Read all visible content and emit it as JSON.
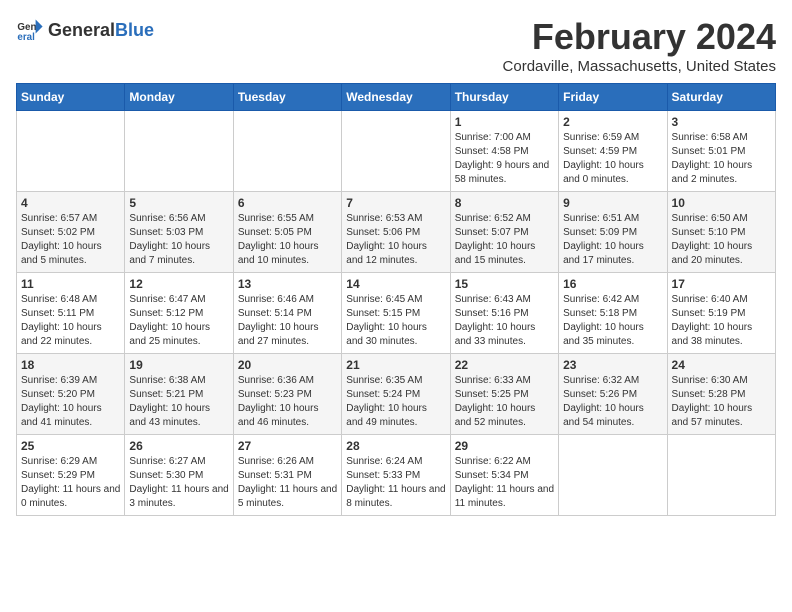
{
  "header": {
    "logo_general": "General",
    "logo_blue": "Blue",
    "month_year": "February 2024",
    "location": "Cordaville, Massachusetts, United States"
  },
  "days_of_week": [
    "Sunday",
    "Monday",
    "Tuesday",
    "Wednesday",
    "Thursday",
    "Friday",
    "Saturday"
  ],
  "weeks": [
    [
      {
        "day": "",
        "info": ""
      },
      {
        "day": "",
        "info": ""
      },
      {
        "day": "",
        "info": ""
      },
      {
        "day": "",
        "info": ""
      },
      {
        "day": "1",
        "info": "Sunrise: 7:00 AM\nSunset: 4:58 PM\nDaylight: 9 hours and 58 minutes."
      },
      {
        "day": "2",
        "info": "Sunrise: 6:59 AM\nSunset: 4:59 PM\nDaylight: 10 hours and 0 minutes."
      },
      {
        "day": "3",
        "info": "Sunrise: 6:58 AM\nSunset: 5:01 PM\nDaylight: 10 hours and 2 minutes."
      }
    ],
    [
      {
        "day": "4",
        "info": "Sunrise: 6:57 AM\nSunset: 5:02 PM\nDaylight: 10 hours and 5 minutes."
      },
      {
        "day": "5",
        "info": "Sunrise: 6:56 AM\nSunset: 5:03 PM\nDaylight: 10 hours and 7 minutes."
      },
      {
        "day": "6",
        "info": "Sunrise: 6:55 AM\nSunset: 5:05 PM\nDaylight: 10 hours and 10 minutes."
      },
      {
        "day": "7",
        "info": "Sunrise: 6:53 AM\nSunset: 5:06 PM\nDaylight: 10 hours and 12 minutes."
      },
      {
        "day": "8",
        "info": "Sunrise: 6:52 AM\nSunset: 5:07 PM\nDaylight: 10 hours and 15 minutes."
      },
      {
        "day": "9",
        "info": "Sunrise: 6:51 AM\nSunset: 5:09 PM\nDaylight: 10 hours and 17 minutes."
      },
      {
        "day": "10",
        "info": "Sunrise: 6:50 AM\nSunset: 5:10 PM\nDaylight: 10 hours and 20 minutes."
      }
    ],
    [
      {
        "day": "11",
        "info": "Sunrise: 6:48 AM\nSunset: 5:11 PM\nDaylight: 10 hours and 22 minutes."
      },
      {
        "day": "12",
        "info": "Sunrise: 6:47 AM\nSunset: 5:12 PM\nDaylight: 10 hours and 25 minutes."
      },
      {
        "day": "13",
        "info": "Sunrise: 6:46 AM\nSunset: 5:14 PM\nDaylight: 10 hours and 27 minutes."
      },
      {
        "day": "14",
        "info": "Sunrise: 6:45 AM\nSunset: 5:15 PM\nDaylight: 10 hours and 30 minutes."
      },
      {
        "day": "15",
        "info": "Sunrise: 6:43 AM\nSunset: 5:16 PM\nDaylight: 10 hours and 33 minutes."
      },
      {
        "day": "16",
        "info": "Sunrise: 6:42 AM\nSunset: 5:18 PM\nDaylight: 10 hours and 35 minutes."
      },
      {
        "day": "17",
        "info": "Sunrise: 6:40 AM\nSunset: 5:19 PM\nDaylight: 10 hours and 38 minutes."
      }
    ],
    [
      {
        "day": "18",
        "info": "Sunrise: 6:39 AM\nSunset: 5:20 PM\nDaylight: 10 hours and 41 minutes."
      },
      {
        "day": "19",
        "info": "Sunrise: 6:38 AM\nSunset: 5:21 PM\nDaylight: 10 hours and 43 minutes."
      },
      {
        "day": "20",
        "info": "Sunrise: 6:36 AM\nSunset: 5:23 PM\nDaylight: 10 hours and 46 minutes."
      },
      {
        "day": "21",
        "info": "Sunrise: 6:35 AM\nSunset: 5:24 PM\nDaylight: 10 hours and 49 minutes."
      },
      {
        "day": "22",
        "info": "Sunrise: 6:33 AM\nSunset: 5:25 PM\nDaylight: 10 hours and 52 minutes."
      },
      {
        "day": "23",
        "info": "Sunrise: 6:32 AM\nSunset: 5:26 PM\nDaylight: 10 hours and 54 minutes."
      },
      {
        "day": "24",
        "info": "Sunrise: 6:30 AM\nSunset: 5:28 PM\nDaylight: 10 hours and 57 minutes."
      }
    ],
    [
      {
        "day": "25",
        "info": "Sunrise: 6:29 AM\nSunset: 5:29 PM\nDaylight: 11 hours and 0 minutes."
      },
      {
        "day": "26",
        "info": "Sunrise: 6:27 AM\nSunset: 5:30 PM\nDaylight: 11 hours and 3 minutes."
      },
      {
        "day": "27",
        "info": "Sunrise: 6:26 AM\nSunset: 5:31 PM\nDaylight: 11 hours and 5 minutes."
      },
      {
        "day": "28",
        "info": "Sunrise: 6:24 AM\nSunset: 5:33 PM\nDaylight: 11 hours and 8 minutes."
      },
      {
        "day": "29",
        "info": "Sunrise: 6:22 AM\nSunset: 5:34 PM\nDaylight: 11 hours and 11 minutes."
      },
      {
        "day": "",
        "info": ""
      },
      {
        "day": "",
        "info": ""
      }
    ]
  ]
}
